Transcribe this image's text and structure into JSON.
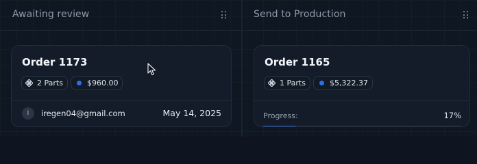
{
  "board": {
    "accent_color": "#2f6fe8",
    "columns": [
      {
        "title": "Awaiting review",
        "card": {
          "order_title": "Order 1173",
          "parts_label": "2 Parts",
          "amount": "$960.00",
          "assignee_initial": "I",
          "assignee_email": "iregen04@gmail.com",
          "date": "May 14, 2025"
        }
      },
      {
        "title": "Send to Production",
        "card": {
          "order_title": "Order 1165",
          "parts_label": "1 Parts",
          "amount": "$5,322.37",
          "progress_label": "Progress:",
          "progress_text": "17%",
          "progress_fraction": 0.17
        }
      }
    ]
  }
}
